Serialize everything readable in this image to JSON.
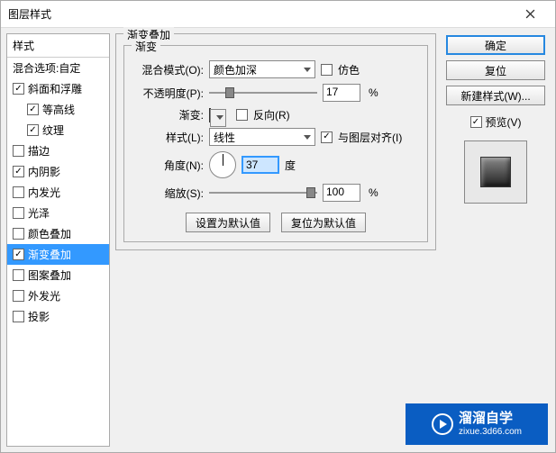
{
  "window": {
    "title": "图层样式"
  },
  "left": {
    "header": "样式",
    "subheader": "混合选项:自定",
    "items": [
      {
        "label": "斜面和浮雕",
        "checked": true
      },
      {
        "label": "等高线",
        "checked": true,
        "indent": true
      },
      {
        "label": "纹理",
        "checked": true,
        "indent": true
      },
      {
        "label": "描边",
        "checked": false
      },
      {
        "label": "内阴影",
        "checked": true
      },
      {
        "label": "内发光",
        "checked": false
      },
      {
        "label": "光泽",
        "checked": false
      },
      {
        "label": "颜色叠加",
        "checked": false
      },
      {
        "label": "渐变叠加",
        "checked": true,
        "selected": true
      },
      {
        "label": "图案叠加",
        "checked": false
      },
      {
        "label": "外发光",
        "checked": false
      },
      {
        "label": "投影",
        "checked": false
      }
    ]
  },
  "center": {
    "group_title": "渐变叠加",
    "inner_title": "渐变",
    "blend_mode_label": "混合模式(O):",
    "blend_mode_value": "颜色加深",
    "dither_label": "仿色",
    "opacity_label": "不透明度(P):",
    "opacity_value": "17",
    "gradient_label": "渐变:",
    "reverse_label": "反向(R)",
    "style_label": "样式(L):",
    "style_value": "线性",
    "align_label": "与图层对齐(I)",
    "angle_label": "角度(N):",
    "angle_value": "37",
    "angle_unit": "度",
    "scale_label": "缩放(S):",
    "scale_value": "100",
    "pct": "%",
    "reset_default": "设置为默认值",
    "restore_default": "复位为默认值"
  },
  "right": {
    "ok": "确定",
    "cancel": "复位",
    "new_style": "新建样式(W)...",
    "preview_label": "预览(V)"
  },
  "watermark": {
    "name": "溜溜自学",
    "url": "zixue.3d66.com"
  }
}
